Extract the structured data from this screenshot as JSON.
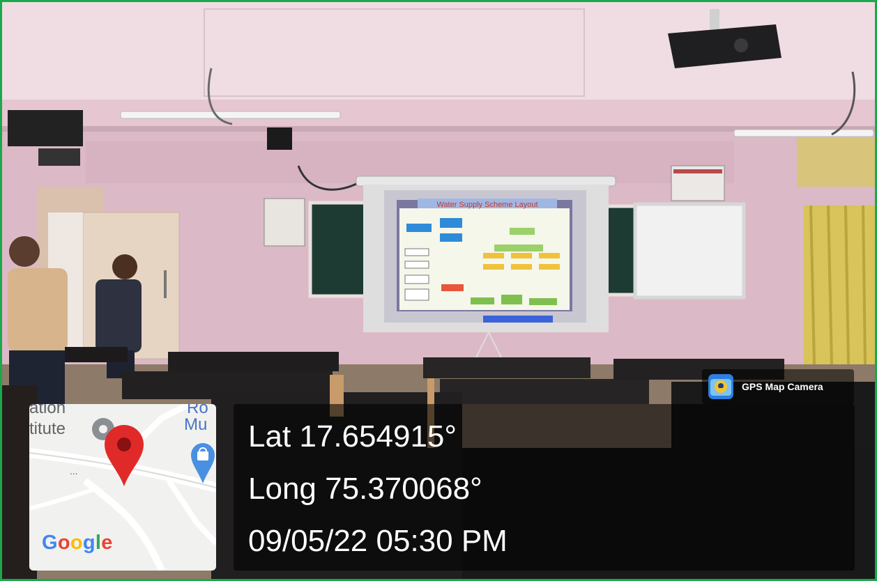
{
  "photo": {
    "description_icon": "classroom-photo",
    "projector_slide_title": "Water Supply Scheme Layout"
  },
  "overlay": {
    "app_badge": {
      "label": "GPS Map Camera",
      "icon": "gps-map-camera-icon"
    },
    "map": {
      "labels": {
        "top_left": "ation",
        "left": "titute",
        "top_right": "Ro",
        "right": "Mu",
        "dots": "..."
      },
      "pin_icon": "red-map-pin-icon",
      "poi_icon": "shopping-bag-poi-icon",
      "brand": "Google",
      "brand_colors": [
        "#4285F4",
        "#EA4335",
        "#FBBC05",
        "#4285F4",
        "#34A853",
        "#EA4335"
      ]
    },
    "coordinates": {
      "lat": "Lat 17.654915°",
      "long": "Long 75.370068°",
      "datetime": "09/05/22 05:30 PM"
    }
  },
  "colors": {
    "border": "#1aa84a",
    "wall": "#dcb9c6",
    "ceiling": "#f0dde4",
    "desk": "#1f1d1e",
    "curtain": "#d8c45a"
  }
}
